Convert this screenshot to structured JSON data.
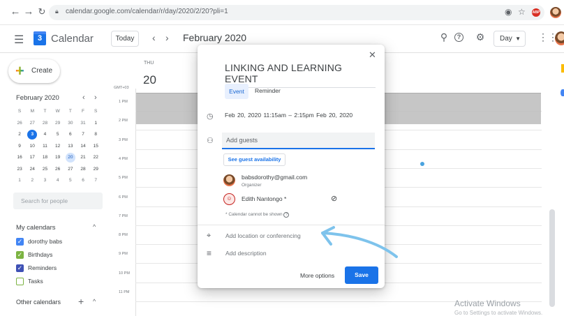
{
  "browser": {
    "url": "calendar.google.com/calendar/r/day/2020/2/20?pli=1",
    "icons": [
      "back-icon",
      "forward-icon",
      "reload-icon",
      "lock-icon",
      "extension-icon",
      "star-icon",
      "abp-icon",
      "profile-avatar"
    ]
  },
  "app": {
    "title": "Calendar",
    "logo_number": "3",
    "today_label": "Today",
    "current_period": "February 2020",
    "view_select": "Day",
    "accent": "#1a73e8"
  },
  "sidebar": {
    "create_label": "Create",
    "mini_month": "February 2020",
    "weekday_headers": [
      "S",
      "M",
      "T",
      "W",
      "T",
      "F",
      "S"
    ],
    "weeks": [
      [
        "26",
        "27",
        "28",
        "29",
        "30",
        "31",
        "1"
      ],
      [
        "2",
        "3",
        "4",
        "5",
        "6",
        "7",
        "8"
      ],
      [
        "9",
        "10",
        "11",
        "12",
        "13",
        "14",
        "15"
      ],
      [
        "16",
        "17",
        "18",
        "19",
        "20",
        "21",
        "22"
      ],
      [
        "23",
        "24",
        "25",
        "26",
        "27",
        "28",
        "29"
      ],
      [
        "1",
        "2",
        "3",
        "4",
        "5",
        "6",
        "7"
      ]
    ],
    "today_day": "3",
    "selected_day": "20",
    "search_placeholder": "Search for people",
    "my_calendars_label": "My calendars",
    "calendars": [
      {
        "label": "dorothy babs",
        "checked": true,
        "color": "#4285f4"
      },
      {
        "label": "Birthdays",
        "checked": true,
        "color": "#7cb342"
      },
      {
        "label": "Reminders",
        "checked": true,
        "color": "#3f51b5"
      },
      {
        "label": "Tasks",
        "checked": false,
        "color": "#7cb342"
      }
    ],
    "other_calendars_label": "Other calendars"
  },
  "day_view": {
    "day_name": "THU",
    "day_number": "20",
    "timezone": "GMT+03",
    "hours": [
      "1 PM",
      "2 PM",
      "3 PM",
      "4 PM",
      "5 PM",
      "6 PM",
      "7 PM",
      "8 PM",
      "9 PM",
      "10 PM",
      "11 PM"
    ]
  },
  "dialog": {
    "title": "LINKING AND LEARNING EVENT",
    "tab_event": "Event",
    "tab_reminder": "Reminder",
    "datetime": "Feb 20, 2020   11:15am  –  2:15pm   Feb 20, 2020",
    "guests_placeholder": "Add guests",
    "availability_button": "See guest availability",
    "guest1_email": "babsdorothy@gmail.com",
    "guest1_role": "Organizer",
    "guest2_name": "Edith Nantongo *",
    "calendar_note": "* Calendar cannot be shown",
    "location_placeholder": "Add location or conferencing",
    "description_placeholder": "Add description",
    "more_options_label": "More options",
    "save_label": "Save"
  },
  "watermark": {
    "line1": "Activate Windows",
    "line2": "Go to Settings to activate Windows."
  }
}
